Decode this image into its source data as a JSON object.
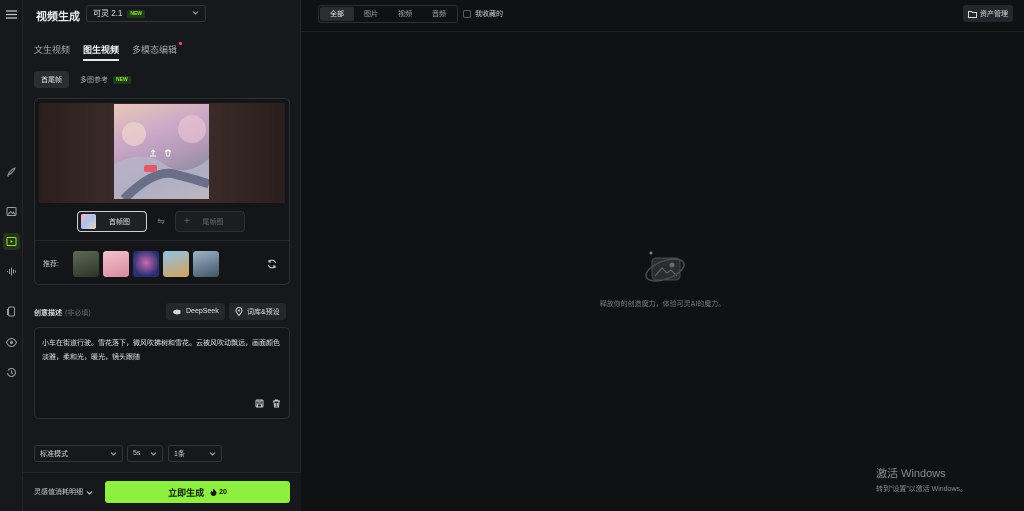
{
  "colors": {
    "accent": "#8df041",
    "background": "#101113",
    "panel": "#17181b",
    "new_badge": "#8fe33e"
  },
  "rail": {
    "icons": [
      "menu-icon",
      "brush-icon",
      "image-icon",
      "video-icon",
      "audio-icon",
      "copy-icon",
      "eye-icon",
      "history-icon"
    ],
    "active": "video-icon"
  },
  "panel": {
    "title": "视频生成",
    "model": {
      "name": "可灵 2.1",
      "badge": "NEW"
    },
    "tabs": [
      {
        "label": "文生视频"
      },
      {
        "label": "图生视频",
        "active": true
      },
      {
        "label": "多模态编辑",
        "has_dot": true
      }
    ],
    "subtabs": [
      {
        "label": "首尾帧",
        "active": true
      },
      {
        "label": "多图参考",
        "badge": "NEW"
      }
    ],
    "frames": {
      "start_label": "首帧图",
      "end_label": "尾帧图"
    },
    "recommend_label": "推荐:",
    "recommend_thumbs": [
      "#3e4a3c",
      "#e6a3b4",
      "#3a3f8f",
      "#c9b37a",
      "#5c7a8f"
    ],
    "description": {
      "label": "创意描述",
      "optional": "(非必填)",
      "deepseek_label": "DeepSeek",
      "presets_label": "词库&预设",
      "prompt": "小车在街道行驶。雪花落下，微风吹拂树和雪花。云被风吹动飘远，画面颜色淡雅，柔和光，暖光，镜头跟随"
    },
    "settings": {
      "mode": "标准模式",
      "duration": "5s",
      "count": "1条"
    },
    "cost_detail_label": "灵感值消耗明细",
    "generate_label": "立即生成",
    "generate_cost": "20"
  },
  "main": {
    "filters": [
      {
        "label": "全部",
        "active": true
      },
      {
        "label": "图片"
      },
      {
        "label": "视频"
      },
      {
        "label": "音频"
      }
    ],
    "favorites_label": "我收藏的",
    "asset_label": "资产管理",
    "empty_text": "释放你的创造魔力，体验可灵AI的魔力。"
  },
  "watermark": {
    "line1": "激活 Windows",
    "line2": "转到“设置”以激活 Windows。"
  }
}
